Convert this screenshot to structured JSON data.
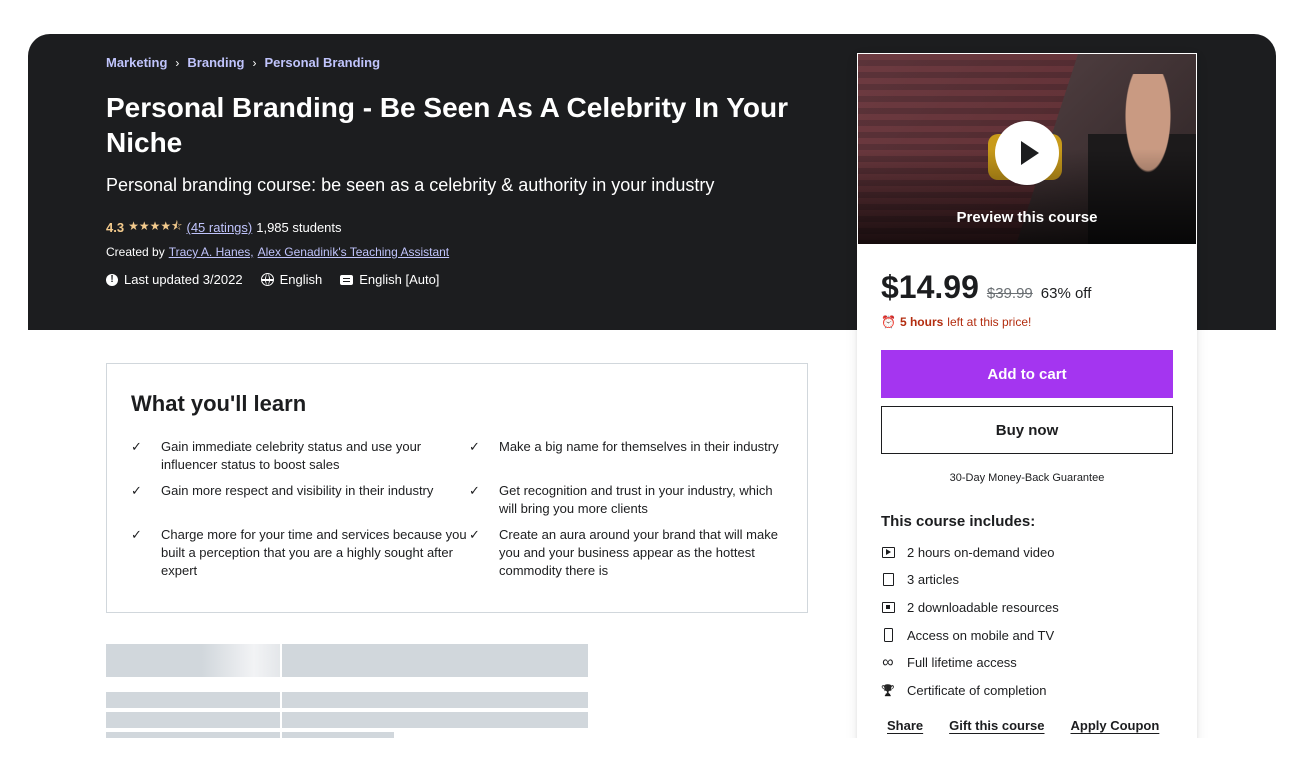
{
  "breadcrumb": [
    "Marketing",
    "Branding",
    "Personal Branding"
  ],
  "breadcrumb_separator": "›",
  "course": {
    "title": "Personal Branding - Be Seen As A Celebrity In Your Niche",
    "subtitle": "Personal branding course: be seen as a celebrity & authority in your industry",
    "rating": "4.3",
    "stars": "★★★★⯪",
    "ratings_link": "(45 ratings)",
    "students": "1,985 students",
    "created_by_label": "Created by",
    "instructor_1": "Tracy A. Hanes,",
    "instructor_2": "Alex Genadinik's Teaching Assistant",
    "last_updated": "Last updated 3/2022",
    "language": "English",
    "captions": "English [Auto]"
  },
  "learn": {
    "heading": "What you'll learn",
    "check_glyph": "✓",
    "items": [
      "Gain immediate celebrity status and use your influencer status to boost sales",
      "Make a big name for themselves in their industry",
      "Gain more respect and visibility in their industry",
      "Get recognition and trust in your industry, which will bring you more clients",
      "Charge more for your time and services because you built a perception that you are a highly sought after expert",
      "Create an aura around your brand that will make you and your business appear as the hottest commodity there is"
    ]
  },
  "sidebar": {
    "preview_label": "Preview this course",
    "price": "$14.99",
    "original_price": "$39.99",
    "discount": "63% off",
    "timer_icon": "⏰",
    "timer_bold": "5 hours",
    "timer_rest": "left at this price!",
    "add_to_cart": "Add to cart",
    "buy_now": "Buy now",
    "guarantee": "30-Day Money-Back Guarantee",
    "includes_title": "This course includes:",
    "includes": [
      {
        "icon": "video-icon",
        "text": "2 hours on-demand video"
      },
      {
        "icon": "file-icon",
        "text": "3 articles"
      },
      {
        "icon": "download-icon",
        "text": "2 downloadable resources"
      },
      {
        "icon": "mobile-icon",
        "text": "Access on mobile and TV"
      },
      {
        "icon": "infinity-icon",
        "glyph": "∞",
        "text": "Full lifetime access"
      },
      {
        "icon": "trophy-icon",
        "glyph": "🏆",
        "text": "Certificate of completion"
      }
    ],
    "share": "Share",
    "gift": "Gift this course",
    "coupon": "Apply Coupon"
  },
  "colors": {
    "hero_bg": "#1c1d1f",
    "accent_purple": "#a435f0",
    "breadcrumb_lilac": "#c0c4fc",
    "rating_gold": "#f3ca8c",
    "timer_red": "#b32d0f"
  }
}
